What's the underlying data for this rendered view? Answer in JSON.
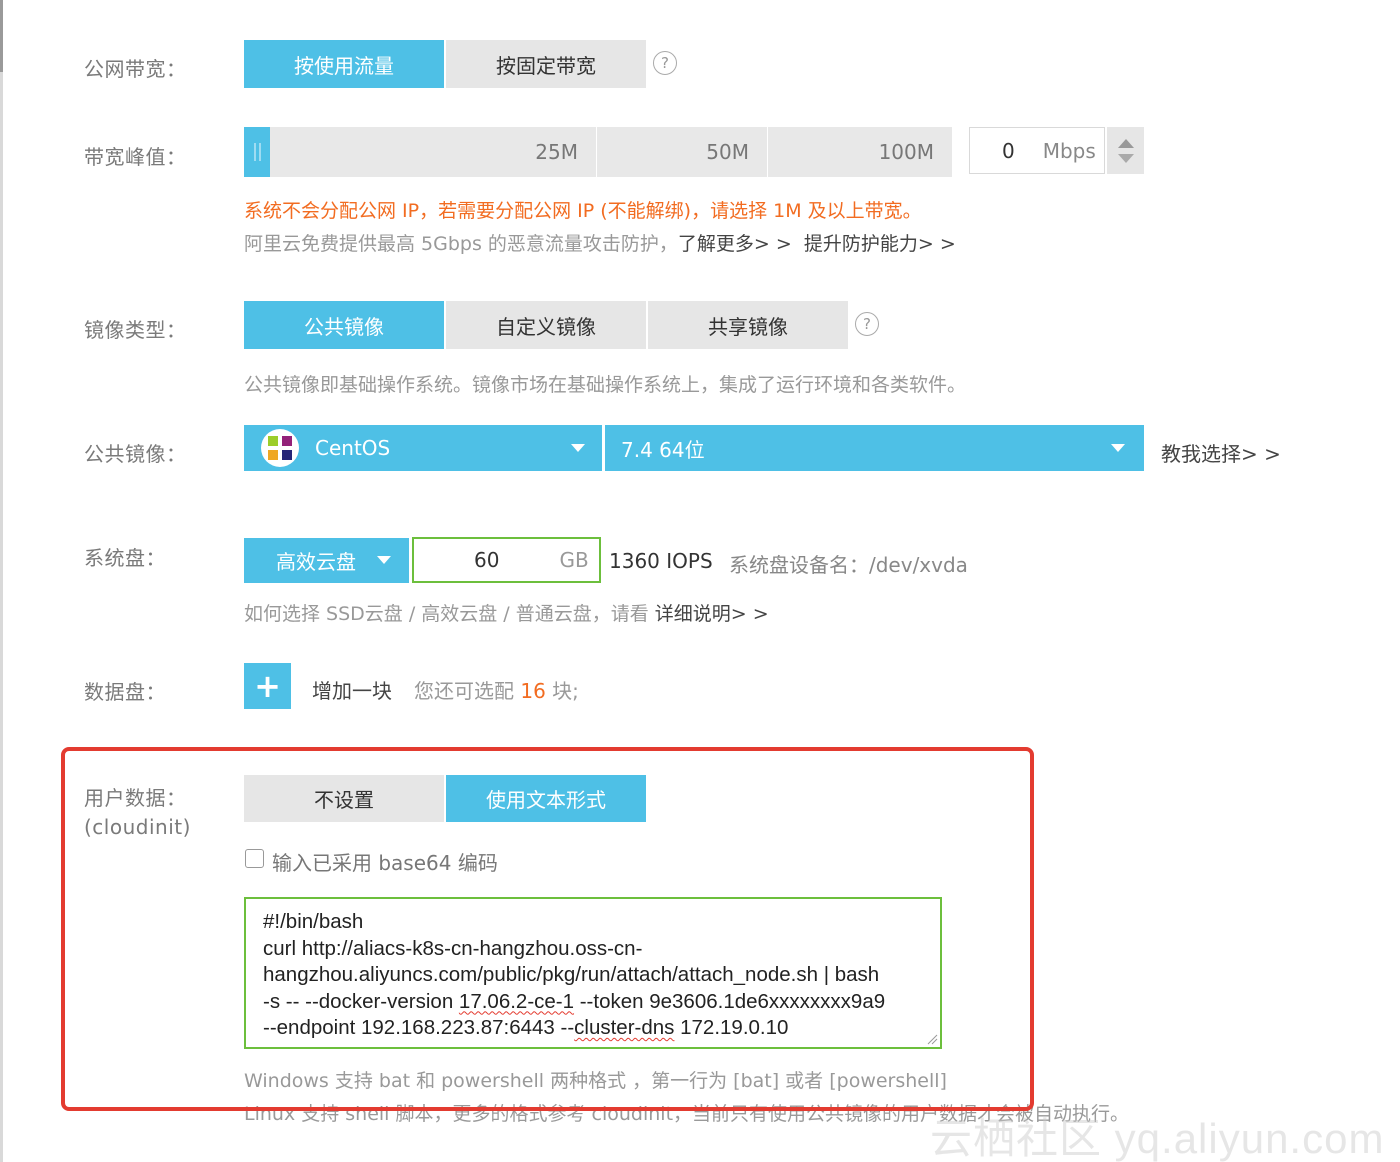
{
  "bandwidth": {
    "label": "公网带宽：",
    "options": [
      "按使用流量",
      "按固定带宽"
    ],
    "help_icon": "question-circle-icon"
  },
  "peak": {
    "label": "带宽峰值：",
    "ticks": [
      "25M",
      "50M",
      "100M"
    ],
    "value": "0",
    "unit": "Mbps",
    "warning": "系统不会分配公网 IP，若需要分配公网 IP (不能解绑)，请选择 1M 及以上带宽。",
    "ddos_note": "阿里云免费提供最高 5Gbps 的恶意流量攻击防护，",
    "learn_more": "了解更多> >",
    "improve": "提升防护能力> >"
  },
  "image_type": {
    "label": "镜像类型：",
    "options": [
      "公共镜像",
      "自定义镜像",
      "共享镜像"
    ],
    "description": "公共镜像即基础操作系统。镜像市场在基础操作系统上，集成了运行环境和各类软件。"
  },
  "public_image": {
    "label": "公共镜像：",
    "os": "CentOS",
    "version": "7.4 64位",
    "help_link": "教我选择> >"
  },
  "system_disk": {
    "label": "系统盘：",
    "type": "高效云盘",
    "size": "60",
    "unit": "GB",
    "iops": "1360 IOPS",
    "device": "系统盘设备名：/dev/xvda",
    "hint": "如何选择 SSD云盘 / 高效云盘 / 普通云盘，请看 ",
    "hint_link": "详细说明> >"
  },
  "data_disk": {
    "label": "数据盘：",
    "add_label": "增加一块",
    "remain_prefix": "您还可选配 ",
    "remain_count": "16",
    "remain_suffix": " 块;"
  },
  "user_data": {
    "label": "用户数据：",
    "sublabel": "(cloudinit)",
    "options": [
      "不设置",
      "使用文本形式"
    ],
    "checkbox_label": "输入已采用 base64 编码",
    "script": {
      "l1": "#!/bin/bash",
      "l2": "curl http://aliacs-k8s-cn-hangzhou.oss-cn-",
      "l3": "hangzhou.aliyuncs.com/public/pkg/run/attach/attach_node.sh | bash",
      "l4a": "-s -- --docker-version ",
      "l4b": "17.06.2-ce-1",
      "l4c": " --token 9e3606.1de6xxxxxxxx9a9",
      "l5a": "--endpoint 192.168.223.87:6443 --",
      "l5b": "cluster-dns",
      "l5c": " 172.19.0.10"
    },
    "windows_note": "Windows 支持 bat 和 powershell 两种格式 ，第一行为 [bat] 或者 [powershell]",
    "linux_note": "Linux 支持 shell 脚本，更多的格式参考 cloudinit，当前只有使用公共镜像的用户数据才会被自动执行。"
  },
  "watermark": "云栖社区 yq.aliyun.com",
  "colors": {
    "accent": "#4ec0e6",
    "warning": "#f26c21",
    "highlight_frame": "#e33b30",
    "input_focus": "#6cbf3c"
  }
}
